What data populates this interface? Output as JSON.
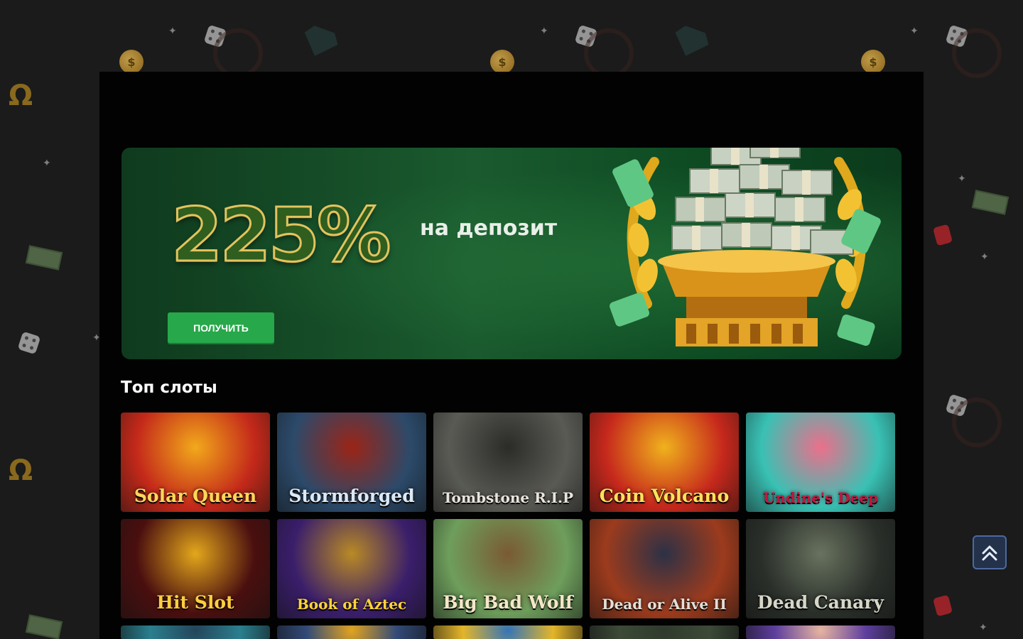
{
  "promo": {
    "percent": "225%",
    "subtitle": "на депозит",
    "button_label": "ПОЛУЧИТЬ"
  },
  "top_slots": {
    "title": "Топ слоты",
    "rows": [
      [
        {
          "name": "Solar Queen",
          "bg": "#c4291a",
          "accent": "#f2a91b",
          "text_color": "#ffd75a"
        },
        {
          "name": "Stormforged",
          "bg": "#2c4a6a",
          "accent": "#9b2416",
          "text_color": "#dce9f5"
        },
        {
          "name": "Tombstone R.I.P",
          "bg": "#5a5a55",
          "accent": "#2b2b28",
          "text_color": "#e8e4dc"
        },
        {
          "name": "Coin Volcano",
          "bg": "#c6281c",
          "accent": "#f0b21d",
          "text_color": "#ffe25a"
        },
        {
          "name": "Undine's Deep",
          "bg": "#39c1b4",
          "accent": "#ec6f8b",
          "text_color": "#c2163f"
        }
      ],
      [
        {
          "name": "Hit Slot",
          "bg": "#4a0f0f",
          "accent": "#e3a71c",
          "text_color": "#ffcf3e"
        },
        {
          "name": "Book of Aztec",
          "bg": "#3a1e6b",
          "accent": "#b98a25",
          "text_color": "#ffd437"
        },
        {
          "name": "Big Bad Wolf",
          "bg": "#6e9e5c",
          "accent": "#7a5a33",
          "text_color": "#f4e8c8"
        },
        {
          "name": "Dead or Alive II",
          "bg": "#9c3b1d",
          "accent": "#2c3146",
          "text_color": "#e2dfd8"
        },
        {
          "name": "Dead Canary",
          "bg": "#2a2f2a",
          "accent": "#69725f",
          "text_color": "#d6d7c8"
        }
      ],
      [
        {
          "name": "",
          "bg": "#2a7f8e",
          "accent": "#24455a",
          "text_color": "#ffffff"
        },
        {
          "name": "",
          "bg": "#324a78",
          "accent": "#e2a320",
          "text_color": "#ffffff"
        },
        {
          "name": "",
          "bg": "#e3b52a",
          "accent": "#3574b7",
          "text_color": "#ffffff"
        },
        {
          "name": "",
          "bg": "#3c4a37",
          "accent": "#2f3a2c",
          "text_color": "#ffffff"
        },
        {
          "name": "",
          "bg": "#5e3f9e",
          "accent": "#e6b4a0",
          "text_color": "#ffffff"
        }
      ]
    ]
  },
  "icons": {
    "scroll_top": "double-chevron-up-icon"
  }
}
